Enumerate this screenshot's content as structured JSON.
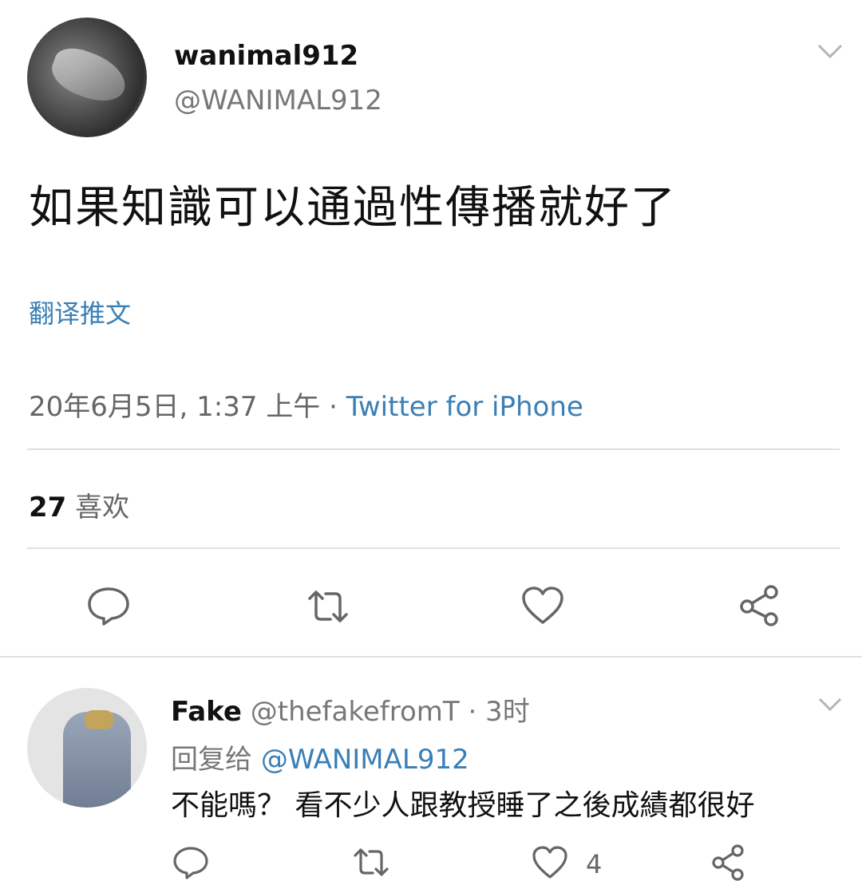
{
  "tweet": {
    "author_name": "wanimal912",
    "author_handle": "@WANIMAL912",
    "text": "如果知識可以通過性傳播就好了",
    "translate_label": "翻译推文",
    "timestamp": "20年6月5日, 1:37 上午 · ",
    "source": "Twitter for iPhone",
    "likes_count": "27",
    "likes_label": " 喜欢"
  },
  "reply": {
    "author_name": "Fake",
    "author_handle": " @thefakefromT · 3时",
    "replying_to_label": "回复给 ",
    "replying_to_handle": "@WANIMAL912",
    "text": "不能嗎？ 看不少人跟教授睡了之後成績都很好",
    "like_count": "4"
  },
  "icons": {
    "menu": "chevron-down-icon",
    "reply": "reply-icon",
    "retweet": "retweet-icon",
    "like": "heart-icon",
    "share": "share-icon"
  },
  "colors": {
    "link": "#3a7fb5",
    "muted": "#777777",
    "divider": "#e0e0e0"
  }
}
